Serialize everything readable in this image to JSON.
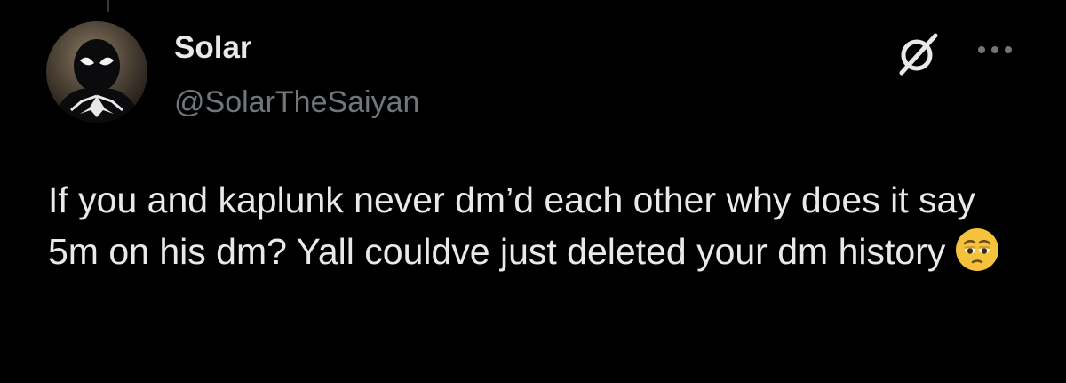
{
  "author": {
    "display_name": "Solar",
    "handle": "@SolarTheSaiyan",
    "avatar_icon": "spider-man-black-suit-avatar"
  },
  "header_actions": {
    "grok_icon": "grok-icon",
    "more_icon": "more-options-icon"
  },
  "tweet": {
    "text": "If you and kaplunk never dm’d each other why does it say 5m on his dm? Yall couldve just deleted your dm history",
    "emoji": "pleading-face-emoji"
  },
  "colors": {
    "background": "#000000",
    "primary_text": "#e7e9ea",
    "secondary_text": "#71767b",
    "emoji_face": "#f5c33b"
  }
}
